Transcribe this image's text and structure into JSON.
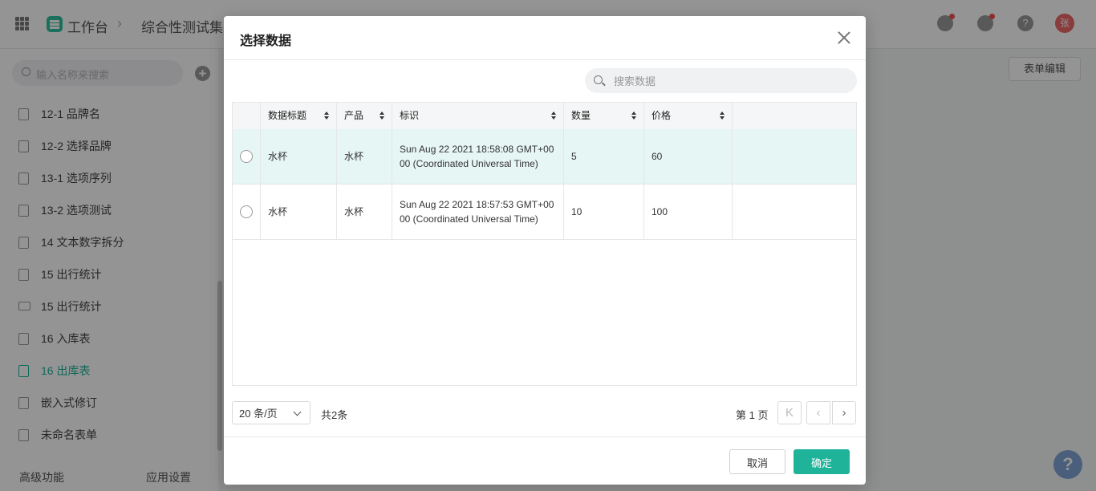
{
  "app": {
    "home": "工作台",
    "breadcrumb_sep": "›",
    "current": "综合性测试集",
    "avatar_text": "张"
  },
  "sidebar": {
    "search_placeholder": "输入名称来搜索",
    "items": [
      {
        "label": "12-1 品牌名",
        "type": "form"
      },
      {
        "label": "12-2 选择品牌",
        "type": "form"
      },
      {
        "label": "13-1 选项序列",
        "type": "form"
      },
      {
        "label": "13-2 选项测试",
        "type": "form"
      },
      {
        "label": "14 文本数字拆分",
        "type": "form"
      },
      {
        "label": "15 出行统计",
        "type": "form"
      },
      {
        "label": "15 出行统计",
        "type": "dashboard"
      },
      {
        "label": "16 入库表",
        "type": "form"
      },
      {
        "label": "16 出库表",
        "type": "form",
        "active": true
      },
      {
        "label": "嵌入式修订",
        "type": "form"
      },
      {
        "label": "未命名表单",
        "type": "form"
      }
    ],
    "footer": {
      "advanced": "高级功能",
      "settings": "应用设置"
    }
  },
  "main": {
    "form_edit": "表单编辑"
  },
  "modal": {
    "title": "选择数据",
    "search_placeholder": "搜索数据",
    "columns": [
      "数据标题",
      "产品",
      "标识",
      "数量",
      "价格"
    ],
    "rows": [
      {
        "title": "水杯",
        "product": "水杯",
        "id": "Sun Aug 22 2021 18:58:08 GMT+0000 (Coordinated Universal Time)",
        "qty": "5",
        "price": "60",
        "selected": true
      },
      {
        "title": "水杯",
        "product": "水杯",
        "id": "Sun Aug 22 2021 18:57:53 GMT+0000 (Coordinated Universal Time)",
        "qty": "10",
        "price": "100",
        "selected": false
      }
    ],
    "page_size": "20 条/页",
    "total": "共2条",
    "page_label": "第 1 页",
    "cancel": "取消",
    "confirm": "确定"
  },
  "colors": {
    "accent": "#1fb39a",
    "selected_row": "#e6f6f4"
  }
}
